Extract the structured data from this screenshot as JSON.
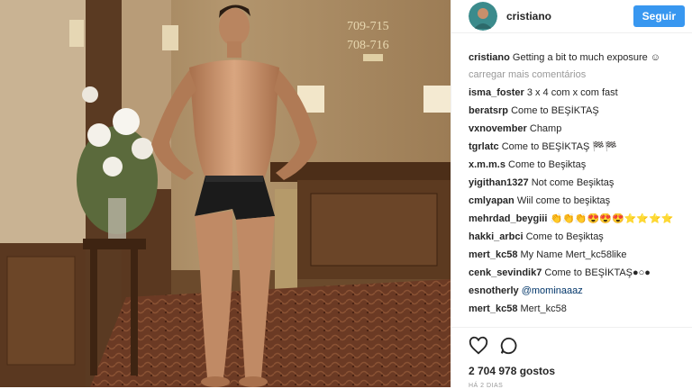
{
  "photo": {
    "alt": "",
    "room_numbers": [
      "709-715",
      "708-716"
    ],
    "colors": {
      "wall": "#a98a63",
      "carpet": "#6b3a24",
      "wood": "#5a3820",
      "skin": "#c89472",
      "underwear": "#1b1b1b"
    }
  },
  "header": {
    "username": "cristiano",
    "follow_label": "Seguir"
  },
  "caption": {
    "user": "cristiano",
    "text": "Getting a bit to much exposure ☺"
  },
  "load_more": "carregar mais comentários",
  "comments": [
    {
      "user": "isma_foster",
      "text": "3 x 4 com x com fast"
    },
    {
      "user": "beratsrp",
      "text": "Come to BEŞİKTAŞ"
    },
    {
      "user": "vxnovember",
      "text": "Champ"
    },
    {
      "user": "tgrlatc",
      "text": "Come to BEŞİKTAŞ 🏁🏁"
    },
    {
      "user": "x.m.m.s",
      "text": "Come to Beşiktaş"
    },
    {
      "user": "yigithan1327",
      "text": "Not come Beşiktaş"
    },
    {
      "user": "cmlyapan",
      "text": "Wiil come to beşiktaş"
    },
    {
      "user": "mehrdad_beygiii",
      "text": "👏👏👏😍😍😍⭐⭐⭐⭐"
    },
    {
      "user": "hakki_arbci",
      "text": "Come to Beşiktaş"
    },
    {
      "user": "mert_kc58",
      "text": "My Name Mert_kc58like"
    },
    {
      "user": "cenk_sevindik7",
      "text": "Come to BEŞİKTAŞ●○●"
    },
    {
      "user": "esnotherly",
      "text": "@mominaaaz"
    },
    {
      "user": "mert_kc58",
      "text": "Mert_kc58"
    }
  ],
  "actions": {
    "likes": "2 704 978 gostos",
    "time": "HÁ 2 DIAS"
  },
  "accent": "#3897f0"
}
